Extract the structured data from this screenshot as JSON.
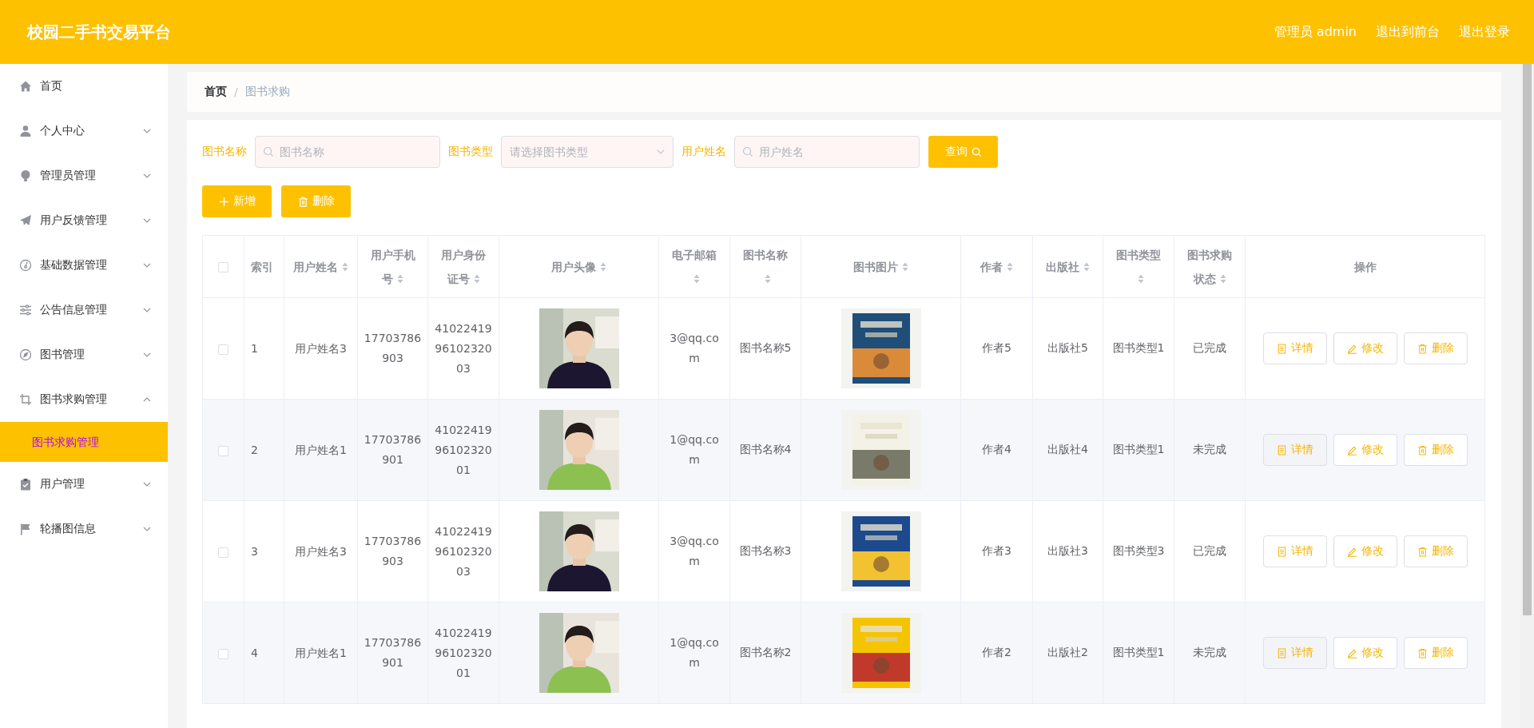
{
  "header": {
    "title": "校园二手书交易平台",
    "links": [
      "管理员 admin",
      "退出到前台",
      "退出登录"
    ]
  },
  "sidebar": {
    "items": [
      {
        "label": "首页"
      },
      {
        "label": "个人中心",
        "expanded": false
      },
      {
        "label": "管理员管理",
        "expanded": false
      },
      {
        "label": "用户反馈管理",
        "expanded": false
      },
      {
        "label": "基础数据管理",
        "expanded": false
      },
      {
        "label": "公告信息管理",
        "expanded": false
      },
      {
        "label": "图书管理",
        "expanded": false
      },
      {
        "label": "图书求购管理",
        "expanded": true,
        "children": [
          {
            "label": "图书求购管理",
            "selected": true
          }
        ]
      },
      {
        "label": "用户管理",
        "expanded": false
      },
      {
        "label": "轮播图信息",
        "expanded": false
      }
    ]
  },
  "breadcrumb": {
    "items": [
      "首页",
      "图书求购"
    ],
    "separator": "/"
  },
  "search": {
    "fields": [
      {
        "kind": "input",
        "label": "图书名称",
        "placeholder": "图书名称"
      },
      {
        "kind": "select",
        "label": "图书类型",
        "placeholder": "请选择图书类型"
      },
      {
        "kind": "input",
        "label": "用户姓名",
        "placeholder": "用户姓名"
      }
    ],
    "button": "查询"
  },
  "actions": [
    {
      "kind": "add",
      "label": "新增"
    },
    {
      "kind": "delete",
      "label": "删除"
    }
  ],
  "table": {
    "select_all": {
      "checked": false
    },
    "columns": [
      {
        "label": "索引",
        "sortable": false
      },
      {
        "label": "用户姓名",
        "sortable": true
      },
      {
        "label": "用户手机号",
        "sortable": true
      },
      {
        "label": "用户身份证号",
        "sortable": true
      },
      {
        "label": "用户头像",
        "sortable": true
      },
      {
        "label": "电子邮箱",
        "sortable": true
      },
      {
        "label": "图书名称",
        "sortable": true
      },
      {
        "label": "图书图片",
        "sortable": true
      },
      {
        "label": "作者",
        "sortable": true
      },
      {
        "label": "出版社",
        "sortable": true
      },
      {
        "label": "图书类型",
        "sortable": true
      },
      {
        "label": "图书求购状态",
        "sortable": true
      },
      {
        "label": "操作",
        "sortable": false
      }
    ],
    "rows": [
      {
        "checked": false,
        "index": "1",
        "name": "用户姓名3",
        "phone": "17703786903",
        "id_card": "410224199610232003",
        "email": "3@qq.com",
        "book_name": "图书名称5",
        "author": "作者5",
        "publisher": "出版社5",
        "book_type": "图书类型1",
        "status": "已完成",
        "buttons": [
          {
            "kind": "detail",
            "label": "详情"
          },
          {
            "kind": "edit",
            "label": "修改"
          },
          {
            "kind": "delete",
            "label": "删除"
          }
        ]
      },
      {
        "checked": false,
        "index": "2",
        "name": "用户姓名1",
        "phone": "17703786901",
        "id_card": "410224199610232001",
        "email": "1@qq.com",
        "book_name": "图书名称4",
        "author": "作者4",
        "publisher": "出版社4",
        "book_type": "图书类型1",
        "status": "未完成",
        "buttons": [
          {
            "kind": "detail",
            "label": "详情"
          },
          {
            "kind": "edit",
            "label": "修改"
          },
          {
            "kind": "delete",
            "label": "删除"
          }
        ]
      },
      {
        "checked": false,
        "index": "3",
        "name": "用户姓名3",
        "phone": "17703786903",
        "id_card": "410224199610232003",
        "email": "3@qq.com",
        "book_name": "图书名称3",
        "author": "作者3",
        "publisher": "出版社3",
        "book_type": "图书类型3",
        "status": "已完成",
        "buttons": [
          {
            "kind": "detail",
            "label": "详情"
          },
          {
            "kind": "edit",
            "label": "修改"
          },
          {
            "kind": "delete",
            "label": "删除"
          }
        ]
      },
      {
        "checked": false,
        "index": "4",
        "name": "用户姓名1",
        "phone": "17703786901",
        "id_card": "410224199610232001",
        "email": "1@qq.com",
        "book_name": "图书名称2",
        "author": "作者2",
        "publisher": "出版社2",
        "book_type": "图书类型1",
        "status": "未完成",
        "buttons": [
          {
            "kind": "detail",
            "label": "详情"
          },
          {
            "kind": "edit",
            "label": "修改"
          },
          {
            "kind": "delete",
            "label": "删除"
          }
        ]
      }
    ]
  }
}
